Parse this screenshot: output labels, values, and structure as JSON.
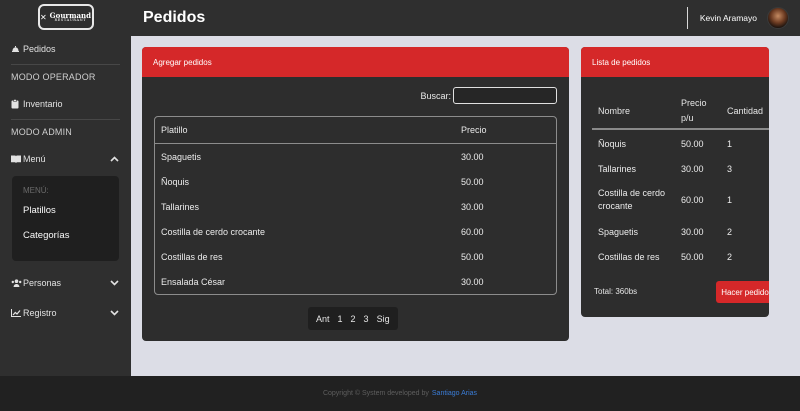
{
  "logo": {
    "name": "Gourmand",
    "tagline": "RESTAURANT"
  },
  "header": {
    "title": "Pedidos",
    "user_name": "Kevin Aramayo"
  },
  "sidebar": {
    "pedidos_label": "Pedidos",
    "operator_section": "MODO OPERADOR",
    "inventario_label": "Inventario",
    "admin_section": "MODO ADMIN",
    "menu_label": "Menú",
    "submenu_title": "MENÚ:",
    "submenu_items": [
      "Platillos",
      "Categorías"
    ],
    "personas_label": "Personas",
    "registro_label": "Registro"
  },
  "add_panel": {
    "title": "Agregar pedidos",
    "search_label": "Buscar:",
    "search_value": "",
    "columns": [
      "Platillo",
      "Precio"
    ],
    "rows": [
      [
        "Spaguetis",
        "30.00"
      ],
      [
        "Ñoquis",
        "50.00"
      ],
      [
        "Tallarines",
        "30.00"
      ],
      [
        "Costilla de cerdo crocante",
        "60.00"
      ],
      [
        "Costillas de res",
        "50.00"
      ],
      [
        "Ensalada César",
        "30.00"
      ]
    ],
    "pagination": [
      "Ant",
      "1",
      "2",
      "3",
      "Sig"
    ]
  },
  "orders_panel": {
    "title": "Lista de pedidos",
    "columns": [
      "Nombre",
      "Precio p/u",
      "Cantidad"
    ],
    "rows": [
      [
        "Ñoquis",
        "50.00",
        "1"
      ],
      [
        "Tallarines",
        "30.00",
        "3"
      ],
      [
        "Costilla de cerdo crocante",
        "60.00",
        "1"
      ],
      [
        "Spaguetis",
        "30.00",
        "2"
      ],
      [
        "Costillas de res",
        "50.00",
        "2"
      ]
    ],
    "total": "Total: 360bs",
    "order_button": "Hacer pedido"
  },
  "footer": {
    "text": "Copyright © System developed by",
    "author": "Santiago Arias"
  },
  "colors": {
    "accent": "#d52829",
    "panel": "#2d2d2d",
    "sidebar": "#2f2f2f",
    "background": "#dcdde6"
  }
}
